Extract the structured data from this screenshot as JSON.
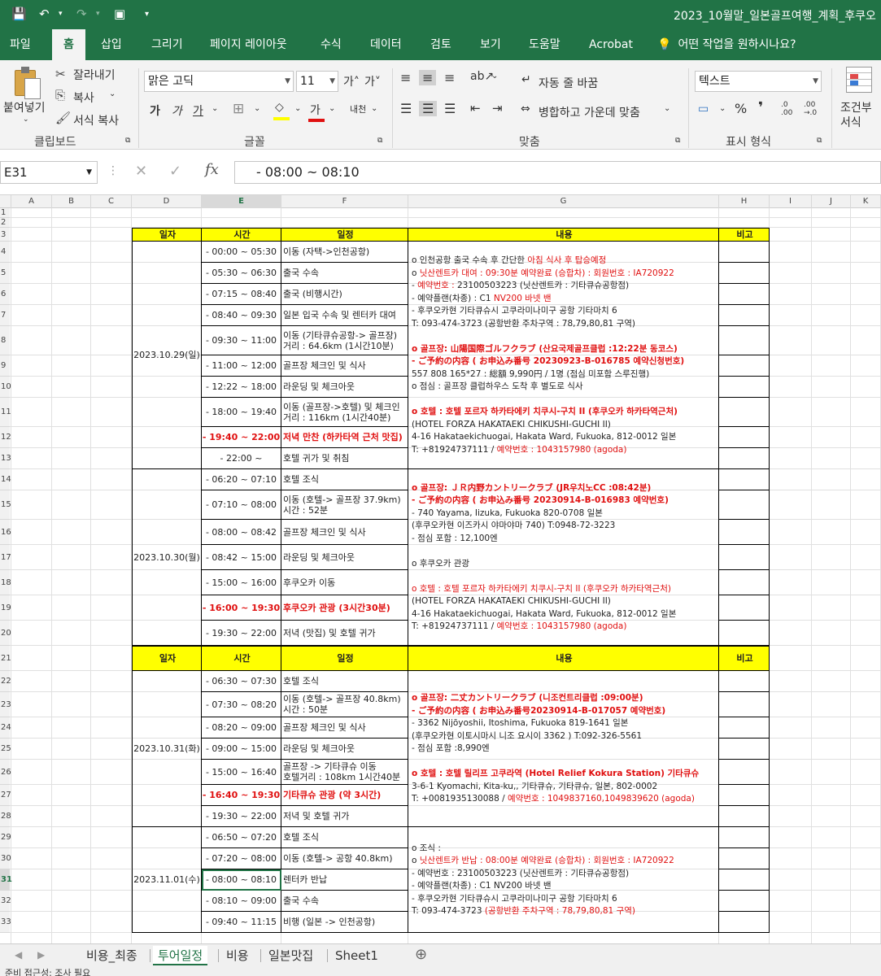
{
  "window": {
    "title": "2023_10월말_일본골프여행_계획_후쿠오"
  },
  "ribbon_tabs": [
    "파일",
    "홈",
    "삽입",
    "그리기",
    "페이지 레이아웃",
    "수식",
    "데이터",
    "검토",
    "보기",
    "도움말",
    "Acrobat",
    "어떤 작업을 원하시나요?"
  ],
  "ribbon": {
    "paste": "붙여넣기",
    "cut": "잘라내기",
    "copy": "복사",
    "format_painter": "서식 복사",
    "group_clipboard": "클립보드",
    "font_name": "맑은 고딕",
    "font_size": "11",
    "bold": "가",
    "italic": "가",
    "underline": "가",
    "font_color": "가",
    "phonetic": "내천",
    "group_font": "글꼴",
    "wrap_text": "자동 줄 바꿈",
    "merge_center": "병합하고 가운데 맞춤",
    "group_align": "맞춤",
    "number_format": "텍스트",
    "percent": "%",
    "comma": "❜",
    "dec_inc": ".0 .00",
    "dec_dec": ".00 →.0",
    "group_number": "표시 형식",
    "cond_format_1": "조건부",
    "cond_format_2": "서식"
  },
  "formula_bar": {
    "name_box": "E31",
    "formula": "- 08:00 ~ 08:10"
  },
  "columns": [
    "A",
    "B",
    "C",
    "D",
    "E",
    "F",
    "G",
    "H",
    "I",
    "J",
    "K"
  ],
  "rows": [
    "1",
    "2",
    "3",
    "4",
    "5",
    "6",
    "7",
    "8",
    "9",
    "10",
    "11",
    "12",
    "13",
    "14",
    "15",
    "16",
    "17",
    "18",
    "19",
    "20",
    "21",
    "22",
    "23",
    "24",
    "25",
    "26",
    "27",
    "28",
    "29",
    "30",
    "31",
    "32",
    "33"
  ],
  "headers": {
    "date": "일자",
    "time": "시간",
    "plan": "일정",
    "content": "내용",
    "note": "비고"
  },
  "days": [
    {
      "date": "2023.10.29(일)",
      "items": [
        {
          "time": "- 00:00 ~ 05:30",
          "plan": "이동 (자택->인천공항)"
        },
        {
          "time": "- 05:30 ~ 06:30",
          "plan": "출국 수속"
        },
        {
          "time": "- 07:15 ~ 08:40",
          "plan": "출국 (비행시간)"
        },
        {
          "time": "- 08:40 ~ 09:30",
          "plan": "일본 입국 수속 및 렌터카 대여"
        },
        {
          "time": "- 09:30 ~ 11:00",
          "plan": "이동 (기타큐슈공항-> 골프장)",
          "plan2": "거리 : 64.6km (1시간10분)"
        },
        {
          "time": "- 11:00 ~ 12:00",
          "plan": "골프장 체크인 및 식사"
        },
        {
          "time": "- 12:22 ~ 18:00",
          "plan": "라운딩 및 체크아웃"
        },
        {
          "time": "- 18:00 ~ 19:40",
          "plan": "이동 (골프장->호텔) 및 체크인",
          "plan2": "거리 : 116km (1시간40분)"
        },
        {
          "time": "- 19:40 ~ 22:00",
          "plan": "저녁 만찬 (하카타역 근처 맛집)",
          "red": true
        },
        {
          "time": "- 22:00 ~",
          "plan": "호텔 귀가 및 취침"
        }
      ],
      "content": [
        {
          "t": "o  인천공항 출국 수속 후 간단한 ",
          "r": "아침 식사 후 탑승예정"
        },
        {
          "t": "o  ",
          "r": "닛산렌트카 대여 : 09:30분 예약완료 (승합차) : 회원번호 : IA720922"
        },
        {
          "t": "   - ",
          "r": "예약번호 : ",
          "t2": "23100503223 (닛산렌트카 : 기타큐슈공항점)"
        },
        {
          "t": "   - 예약플랜(차종) : C1 ",
          "r": "NV200 바넷 밴"
        },
        {
          "t": "   - 후쿠오카현 기타큐슈시 고쿠라미나미구 공항 기타마치 6"
        },
        {
          "t": "       T: 093-474-3723 (공항반환 주차구역 : 78,79,80,81 구역)"
        },
        {
          "t": ""
        },
        {
          "b": "o  골프장:  山陽国際ゴルフクラブ (산요국제골프클럽 :12:22분 동코스)"
        },
        {
          "b": "   - ご予約の内容 ( お申込み番号 20230923-B-016785 예약신청번호)"
        },
        {
          "t": "              557 808 165*27  : 総額 9,990円 / 1명 (점심 미포함 스루진행)"
        },
        {
          "t": "o  점심 : 골프장 클럽하우스 도착 후 별도로 식사"
        },
        {
          "t": ""
        },
        {
          "b": "o  호텔 : 호텔 포르자 하카타에키 치쿠시-구치 II  (후쿠오카 하카타역근처)"
        },
        {
          "t": "              (HOTEL FORZA HAKATAEKI CHIKUSHI-GUCHI II)"
        },
        {
          "t": "              4-16 Hakataekichuogai, Hakata Ward, Fukuoka, 812-0012 일본"
        },
        {
          "t": "              T: +81924737111 / ",
          "r": "예약번호 : 1043157980 (agoda)"
        }
      ]
    },
    {
      "date": "2023.10.30(월)",
      "items": [
        {
          "time": "- 06:20 ~ 07:10",
          "plan": "호텔 조식"
        },
        {
          "time": "- 07:10 ~ 08:00",
          "plan": "이동 (호텔-> 골프장 37.9km)",
          "plan2": "시간 : 52분"
        },
        {
          "time": "- 08:00 ~ 08:42",
          "plan": "골프장 체크인 및 식사"
        },
        {
          "time": "- 08:42 ~ 15:00",
          "plan": "라운딩 및 체크아웃"
        },
        {
          "time": "- 15:00 ~ 16:00",
          "plan": "후쿠오카 이동"
        },
        {
          "time": "- 16:00 ~ 19:30",
          "plan": "후쿠오카 관광 (3시간30분)",
          "red": true
        },
        {
          "time": "- 19:30 ~ 22:00",
          "plan": "저녁 (맛집) 및 호텔 귀가"
        }
      ],
      "content": [
        {
          "b": "o  골프장:  ＪＲ内野カントリークラブ (JR우치노CC :08:42분)"
        },
        {
          "b": "   - ご予約の内容 ( お申込み番号 20230914-B-016983 예약번호)"
        },
        {
          "t": "   - 740 Yayama, Iizuka, Fukuoka 820-0708 일본"
        },
        {
          "t": "     (후쿠오카현 이즈카시 야마야마 740) T:0948-72-3223"
        },
        {
          "t": "   - 점심 포함 : 12,100엔"
        },
        {
          "t": ""
        },
        {
          "t": "o  후쿠오카 관광"
        },
        {
          "t": ""
        },
        {
          "r": "o  호텔 : 호텔 포르자 하카타에키 치쿠시-구치 II  (후쿠오카 하카타역근처)"
        },
        {
          "t": "              (HOTEL FORZA HAKATAEKI CHIKUSHI-GUCHI II)"
        },
        {
          "t": "              4-16 Hakataekichuogai, Hakata Ward, Fukuoka, 812-0012 일본"
        },
        {
          "t": "              T: +81924737111 / ",
          "r": "예약번호 : 1043157980 (agoda)"
        }
      ]
    },
    {
      "date": "2023.10.31(화)",
      "items": [
        {
          "time": "- 06:30 ~ 07:30",
          "plan": "호텔 조식"
        },
        {
          "time": "- 07:30 ~ 08:20",
          "plan": "이동 (호텔-> 골프장 40.8km)",
          "plan2": "시간 : 50분"
        },
        {
          "time": "- 08:20 ~ 09:00",
          "plan": "골프장 체크인 및 식사"
        },
        {
          "time": "- 09:00 ~ 15:00",
          "plan": "라운딩 및 체크아웃"
        },
        {
          "time": "- 15:00 ~ 16:40",
          "plan": "골프장 -> 기타큐슈 이동",
          "plan2": "호텔거리 : 108km 1시간40분"
        },
        {
          "time": "- 16:40 ~ 19:30",
          "plan": "기타큐슈 관광 (약 3시간)",
          "red": true
        },
        {
          "time": "- 19:30 ~ 22:00",
          "plan": "저녁 및 호텔 귀가"
        }
      ],
      "content": [
        {
          "b": "o  골프장:  二丈カントリークラブ (니조컨트리클럽 :09:00분)"
        },
        {
          "b": "   - ご予約の内容 ( お申込み番号20230914-B-017057 예약번호)"
        },
        {
          "t": "   - 3362 Nijōyoshii, Itoshima, Fukuoka 819-1641 일본"
        },
        {
          "t": "     (후쿠오카현 이토시마시 니조 요시이 3362 ) T:092-326-5561"
        },
        {
          "t": "   - 점심 포함 :8,990엔"
        },
        {
          "t": ""
        },
        {
          "b": "o  호텔 : 호텔 릴리프 고쿠라역 (Hotel Relief Kokura Station) 기타큐슈"
        },
        {
          "t": "              3-6-1 Kyomachi, Kita-ku,, 기타큐슈, 기타큐슈, 일본, 802-0002"
        },
        {
          "t": "              T: +0081935130088 / ",
          "r": "예약번호 : 1049837160,1049839620 (agoda)"
        }
      ]
    },
    {
      "date": "2023.11.01(수)",
      "items": [
        {
          "time": "- 06:50 ~ 07:20",
          "plan": "호텔 조식"
        },
        {
          "time": "- 07:20 ~ 08:00",
          "plan": "이동 (호텔-> 공항 40.8km)"
        },
        {
          "time": "- 08:00 ~ 08:10",
          "plan": "렌터카 반납",
          "selected": true
        },
        {
          "time": "- 08:10 ~ 09:00",
          "plan": "출국 수속"
        },
        {
          "time": "- 09:40 ~ 11:15",
          "plan": "비행 (일본 -> 인천공항)"
        }
      ],
      "content": [
        {
          "t": "o  조식 :"
        },
        {
          "t": "o  ",
          "r": "닛산렌트카 반납 : 08:00분 예약완료 (승합차) : 회원번호 : IA720922"
        },
        {
          "t": "   - 예약번호 :  23100503223 (닛산렌트카 : 기타큐슈공항점)"
        },
        {
          "t": "   - 예약플랜(차종) : C1 NV200 바넷 밴"
        },
        {
          "t": "   - 후쿠오카현 기타큐슈시 고쿠라미나미구 공항 기타마치 6"
        },
        {
          "t": "       T: 093-474-3723 ",
          "r": "(공항반환 주차구역 : 78,79,80,81 구역)"
        }
      ]
    }
  ],
  "sheet_tabs": [
    "비용_최종",
    "투어일정",
    "비용",
    "일본맛집",
    "Sheet1"
  ],
  "active_sheet": "투어일정",
  "status": {
    "text": "준비   접근성: 조사 필요"
  },
  "colors": {
    "excel_green": "#217346",
    "header_yellow": "#ffff00",
    "red": "#e01010"
  }
}
